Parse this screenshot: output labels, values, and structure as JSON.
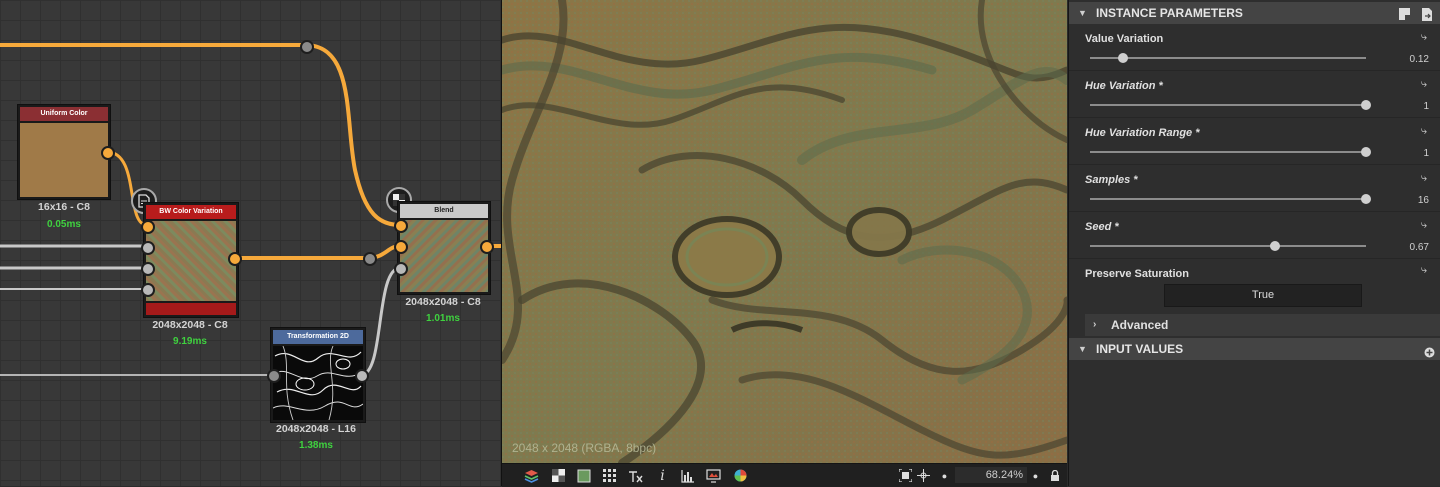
{
  "graph": {
    "nodes": {
      "uniform": {
        "title": "Uniform Color",
        "resolution": "16x16 - C8",
        "time": "0.05ms"
      },
      "bw": {
        "title": "BW Color Variation",
        "resolution": "2048x2048 - C8",
        "time": "9.19ms"
      },
      "blend": {
        "title": "Blend",
        "resolution": "2048x2048 - C8",
        "time": "1.01ms"
      },
      "transform": {
        "title": "Transformation 2D",
        "resolution": "2048x2048 - L16",
        "time": "1.38ms"
      }
    }
  },
  "viewport": {
    "resolution_info": "2048 x 2048 (RGBA, 8bpc)",
    "zoom": "68.24%"
  },
  "icons": {
    "toolbar": [
      "layers-icon",
      "checker-icon",
      "channel-icon",
      "grid-icon",
      "tiling-icon",
      "info-icon",
      "histogram-icon",
      "display-icon",
      "color-wheel-icon",
      "fit-icon",
      "center-icon",
      "zoom-out-icon",
      "zoom-in-icon",
      "lock-icon"
    ]
  },
  "properties": {
    "instance_header": "INSTANCE PARAMETERS",
    "input_header": "INPUT VALUES",
    "params": [
      {
        "label": "Value Variation",
        "value": "0.12",
        "fraction": 0.12,
        "italic": false
      },
      {
        "label": "Hue Variation *",
        "value": "1",
        "fraction": 1.0,
        "italic": true
      },
      {
        "label": "Hue Variation Range *",
        "value": "1",
        "fraction": 1.0,
        "italic": true
      },
      {
        "label": "Samples *",
        "value": "16",
        "fraction": 1.0,
        "italic": true
      },
      {
        "label": "Seed *",
        "value": "0.67",
        "fraction": 0.67,
        "italic": true
      }
    ],
    "preserve_saturation": {
      "label": "Preserve Saturation",
      "value": "True"
    },
    "advanced_label": "Advanced"
  },
  "colors": {
    "wire_orange": "#f6a93b",
    "time_green": "#3fd13f",
    "uniform_header": "#8b2f33",
    "bw_header": "#b81c1c",
    "blend_header": "#c9c9c9",
    "transform_header": "#4d6a9c"
  }
}
